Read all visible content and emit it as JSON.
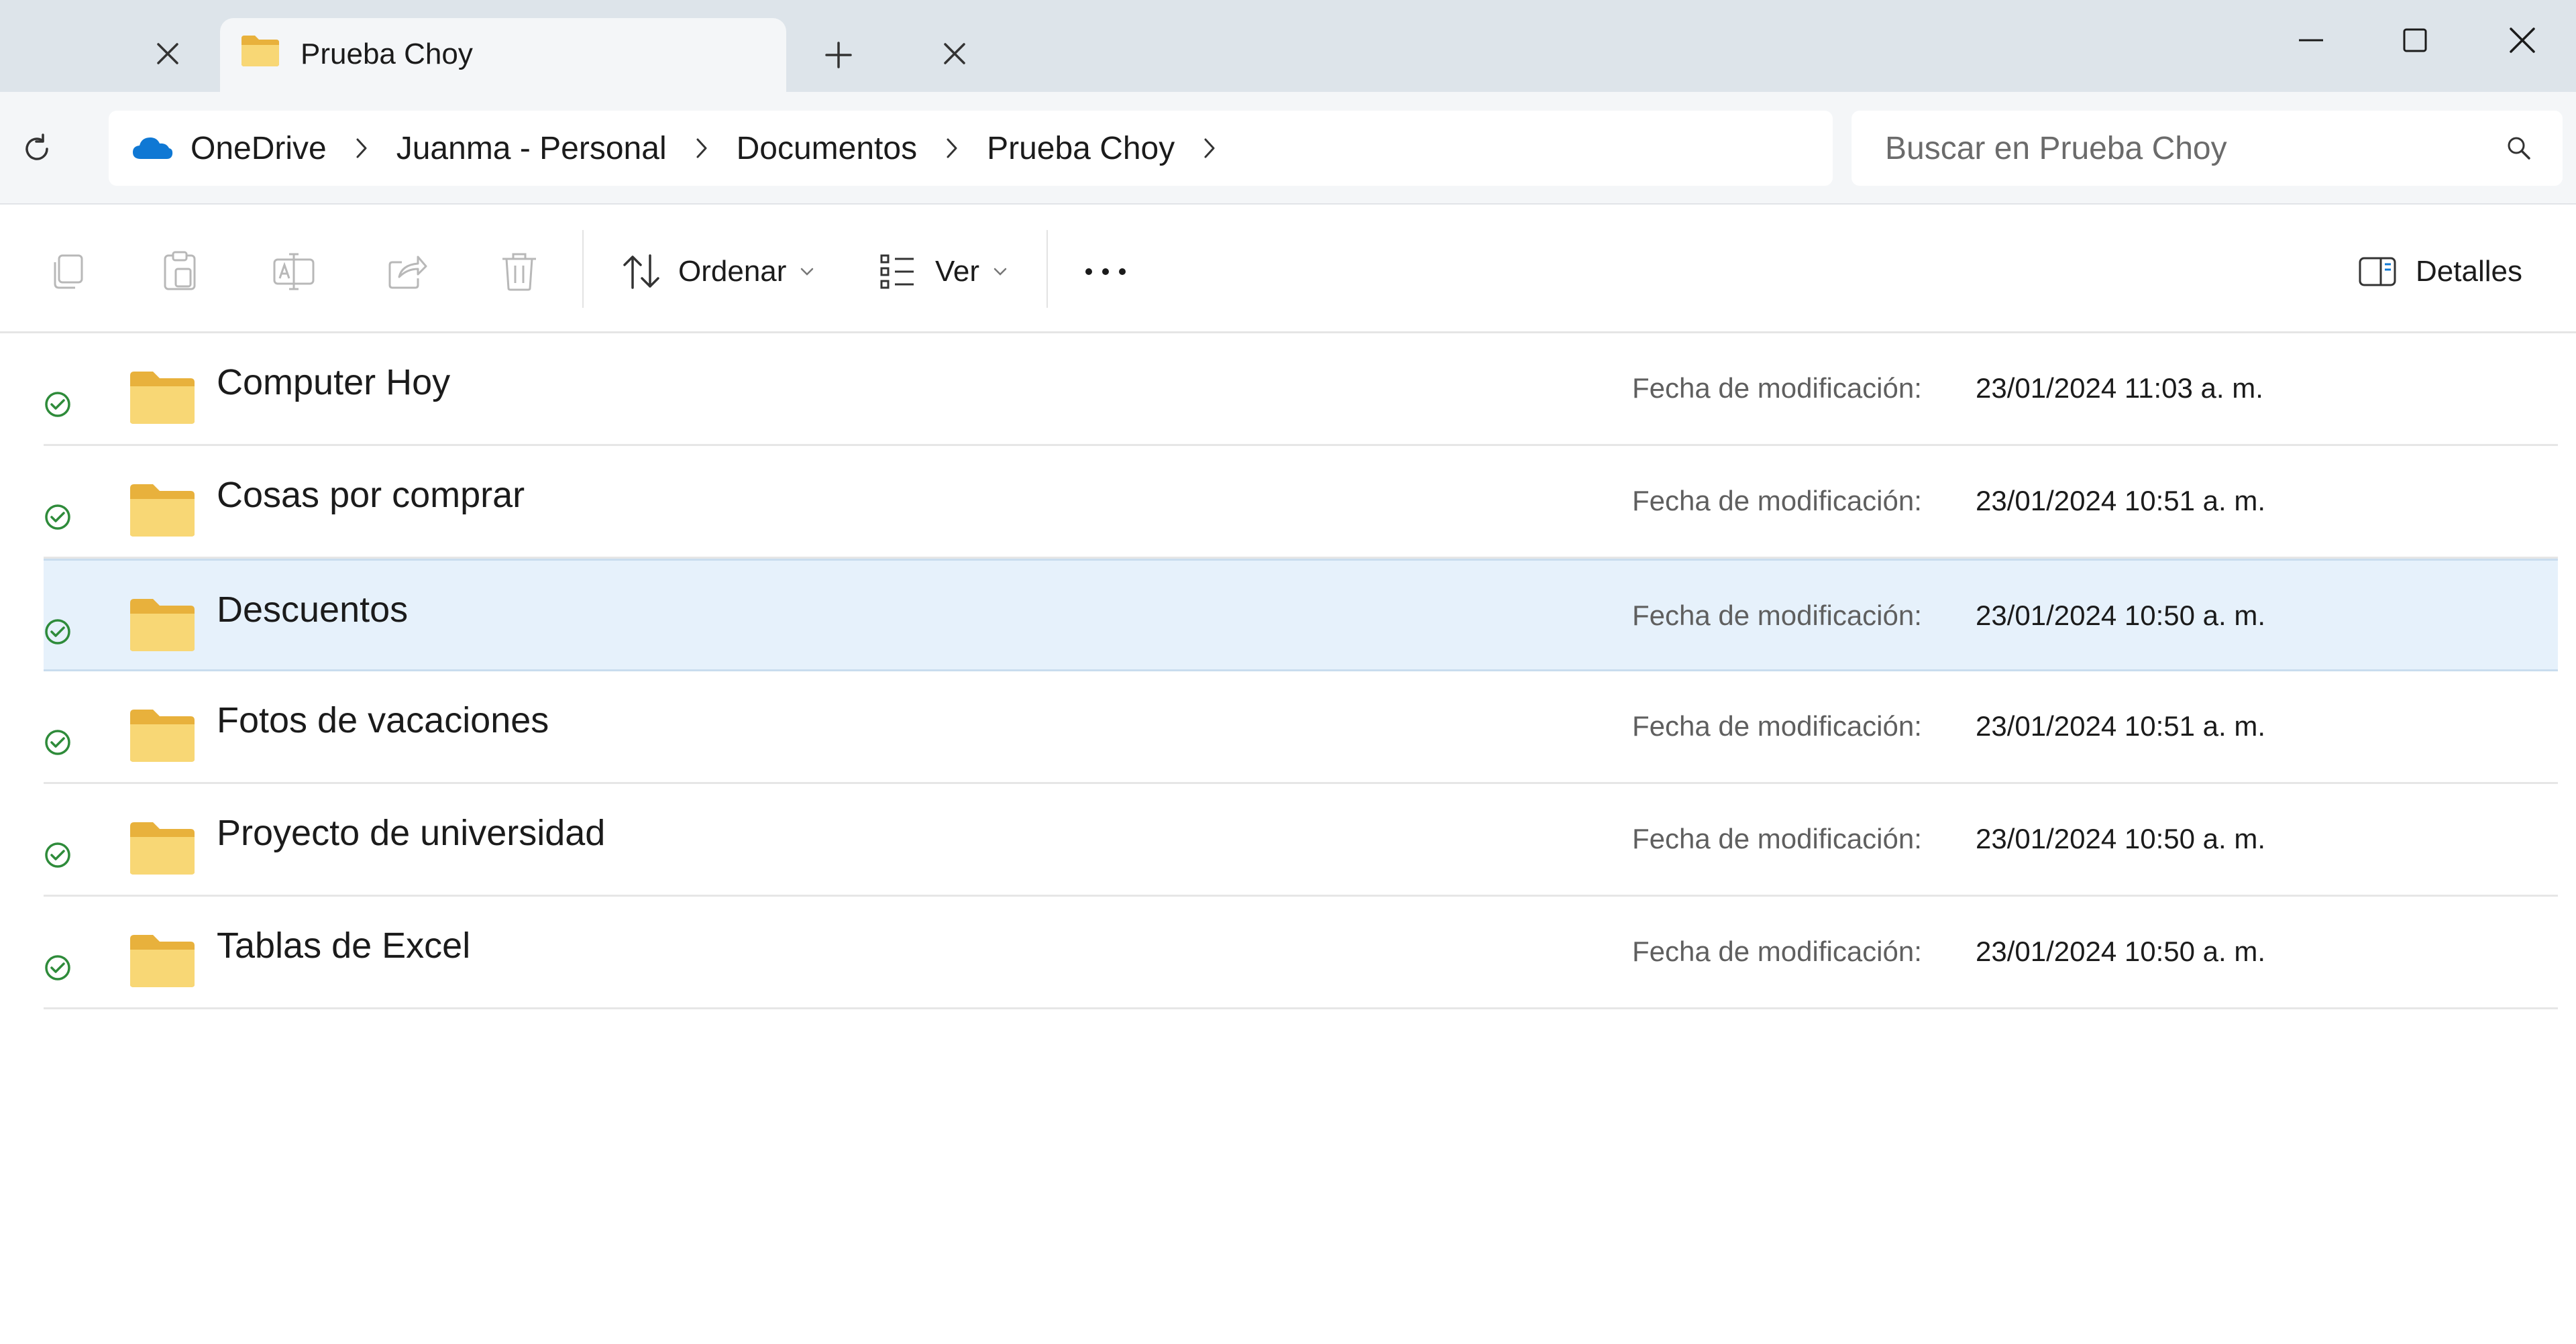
{
  "tabs": [
    {
      "title": "",
      "active": false
    },
    {
      "title": "Prueba Choy",
      "active": true
    }
  ],
  "address": {
    "breadcrumbs": [
      "OneDrive",
      "Juanma - Personal",
      "Documentos",
      "Prueba Choy"
    ]
  },
  "search": {
    "placeholder": "Buscar en Prueba Choy"
  },
  "toolbar": {
    "sort_label": "Ordenar",
    "view_label": "Ver",
    "details_label": "Detalles"
  },
  "files": {
    "date_label": "Fecha de modificación:",
    "items": [
      {
        "name": "Computer Hoy",
        "modified": "23/01/2024 11:03 a. m.",
        "selected": false
      },
      {
        "name": "Cosas por comprar",
        "modified": "23/01/2024 10:51 a. m.",
        "selected": false
      },
      {
        "name": "Descuentos",
        "modified": "23/01/2024 10:50 a. m.",
        "selected": true
      },
      {
        "name": "Fotos de vacaciones",
        "modified": "23/01/2024 10:51 a. m.",
        "selected": false
      },
      {
        "name": "Proyecto de universidad",
        "modified": "23/01/2024 10:50 a. m.",
        "selected": false
      },
      {
        "name": "Tablas de Excel",
        "modified": "23/01/2024 10:50 a. m.",
        "selected": false
      }
    ]
  },
  "colors": {
    "folder": "#f8d775",
    "sync_ok": "#2e8b3a",
    "onedrive": "#0f78d4",
    "selection": "#e6f1fb"
  },
  "icons": [
    "close-icon",
    "folder-icon",
    "add-icon",
    "minimize-icon",
    "maximize-icon",
    "refresh-icon",
    "onedrive-icon",
    "chevron-right-icon",
    "search-icon",
    "copy-icon",
    "paste-icon",
    "rename-icon",
    "share-icon",
    "delete-icon",
    "sort-icon",
    "view-icon",
    "chevron-down-icon",
    "more-icon",
    "details-pane-icon",
    "sync-status-icon"
  ]
}
